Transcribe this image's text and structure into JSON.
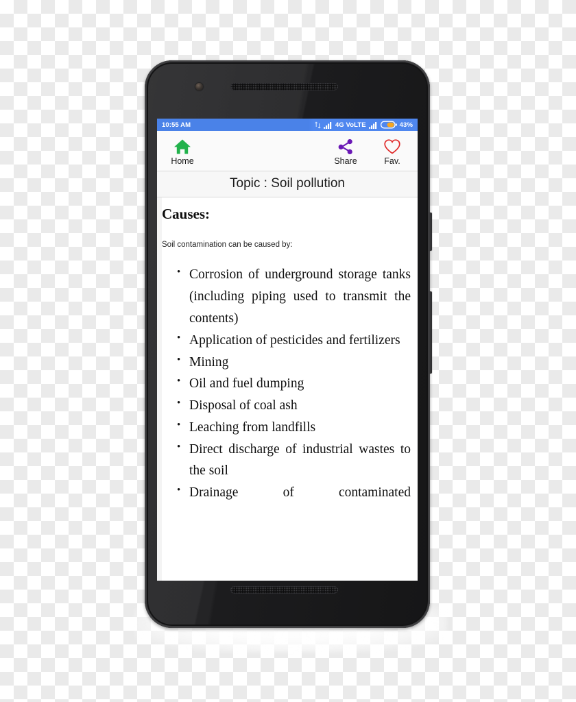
{
  "status_bar": {
    "time": "10:55 AM",
    "network_label": "4G VoLTE",
    "battery_percent": "43%",
    "icons": [
      "data-transfer-icon",
      "signal-bars-icon",
      "signal-bars-icon-2",
      "battery-icon"
    ],
    "background_color": "#4a82e8",
    "text_color": "#ffffff"
  },
  "toolbar": {
    "home": {
      "label": "Home",
      "icon": "home-icon",
      "color": "#22b24c"
    },
    "share": {
      "label": "Share",
      "icon": "share-icon",
      "color": "#6a18b5"
    },
    "favorite": {
      "label": "Fav.",
      "icon": "heart-outline-icon",
      "color": "#e02b2b"
    },
    "background_color": "#fafafa"
  },
  "topic_bar": {
    "title": "Topic : Soil pollution"
  },
  "content": {
    "heading": "Causes:",
    "intro": "Soil contamination can be caused by:",
    "bullets": [
      "Corrosion of underground storage tanks (including piping used to transmit the contents)",
      "Application of pesticides and fertilizers",
      "Mining",
      "Oil and fuel dumping",
      "Disposal of coal ash",
      "Leaching from landfills",
      "Direct discharge of industrial wastes to the soil",
      "Drainage of contaminated"
    ]
  },
  "device": {
    "hardware": [
      "front-camera",
      "earpiece-speaker",
      "bottom-speaker",
      "power-button",
      "volume-button"
    ],
    "body_color": "#1c1c1e"
  }
}
